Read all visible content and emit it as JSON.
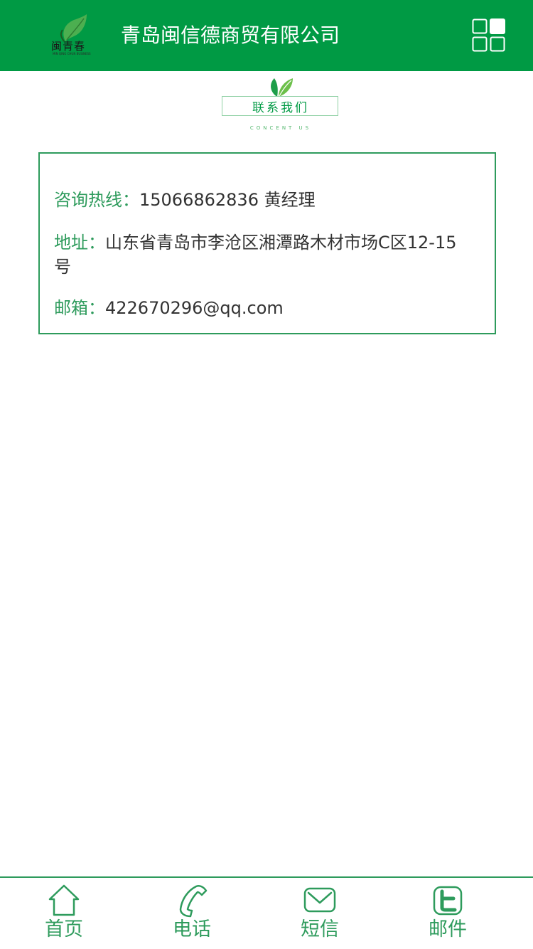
{
  "header": {
    "logo_text": "闽青春",
    "logo_subtext": "MIN QING CHUN BUSINESS",
    "company_title": "青岛闽信德商贸有限公司"
  },
  "section": {
    "title": "联系我们",
    "subtitle": "CONCENT US"
  },
  "contact": {
    "hotline_label": "咨询热线：",
    "hotline_value": "15066862836 黄经理",
    "address_label": "地址：",
    "address_value": "山东省青岛市李沧区湘潭路木材市场C区12-15号",
    "email_label": "邮箱：",
    "email_value": "422670296@qq.com"
  },
  "bottom_nav": {
    "home": "首页",
    "phone": "电话",
    "sms": "短信",
    "mail": "邮件"
  },
  "colors": {
    "brand_green": "#009a44",
    "accent_green": "#2e9b5c",
    "text": "#333333"
  }
}
